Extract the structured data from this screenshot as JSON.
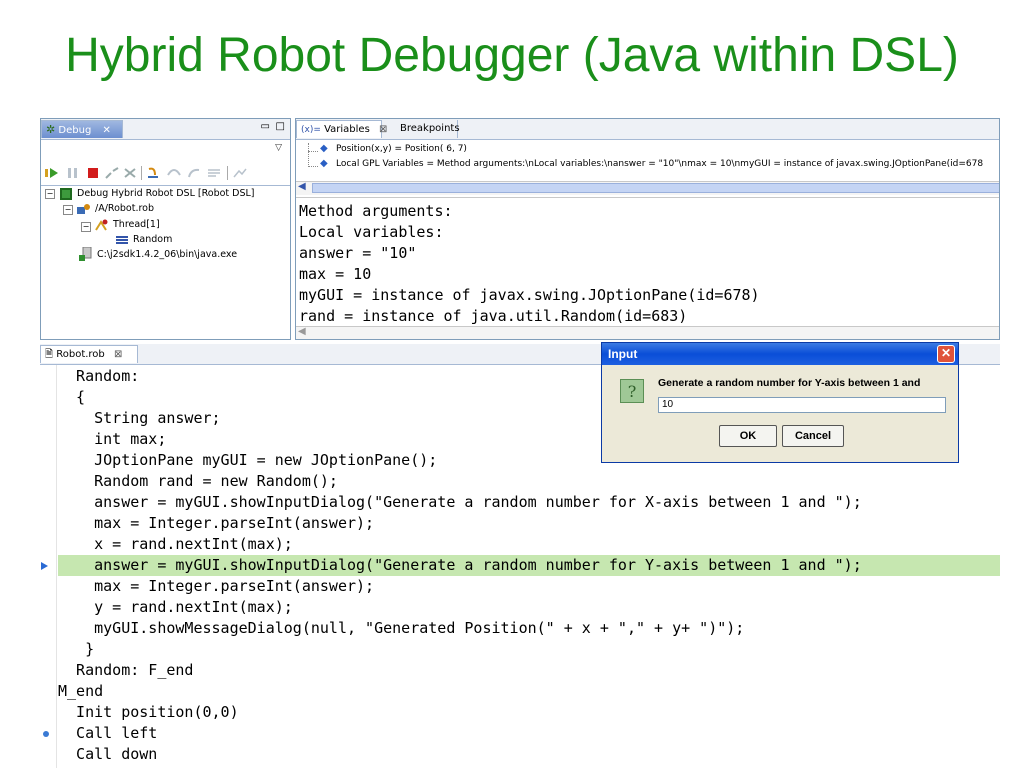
{
  "slide": {
    "title": "Hybrid Robot Debugger (Java within DSL)"
  },
  "debug_view": {
    "tab_label": "Debug",
    "tree": [
      {
        "label": "Debug Hybrid Robot DSL [Robot DSL]"
      },
      {
        "label": "/A/Robot.rob"
      },
      {
        "label": "Thread[1]"
      },
      {
        "label": "Random"
      },
      {
        "label": "C:\\j2sdk1.4.2_06\\bin\\java.exe"
      }
    ]
  },
  "variables_view": {
    "tabs": [
      {
        "label": "Variables"
      },
      {
        "label": "Breakpoints"
      }
    ],
    "rows": [
      {
        "text": "Position(x,y) = Position( 6, 7)"
      },
      {
        "text": "Local GPL Variables = Method arguments:\\nLocal variables:\\nanswer = \"10\"\\nmax = 10\\nmyGUI = instance of javax.swing.JOptionPane(id=678"
      }
    ],
    "detail_lines": [
      "Method arguments:",
      "Local variables:",
      "answer = \"10\"",
      "max = 10",
      "myGUI = instance of javax.swing.JOptionPane(id=678)",
      "rand = instance of java.util.Random(id=683)"
    ]
  },
  "editor": {
    "tab_label": "Robot.rob",
    "lines": [
      "  Random:",
      "  {",
      "    String answer;",
      "    int max;",
      "    JOptionPane myGUI = new JOptionPane();",
      "    Random rand = new Random();",
      "    answer = myGUI.showInputDialog(\"Generate a random number for X-axis between 1 and \");",
      "    max = Integer.parseInt(answer);",
      "    x = rand.nextInt(max);",
      "    answer = myGUI.showInputDialog(\"Generate a random number for Y-axis between 1 and \");",
      "    max = Integer.parseInt(answer);",
      "    y = rand.nextInt(max);",
      "    myGUI.showMessageDialog(null, \"Generated Position(\" + x + \",\" + y+ \")\");",
      "   }",
      "  Random: F_end",
      "M_end",
      "  Init position(0,0)",
      "  Call left",
      "  Call down"
    ],
    "current_line_index": 9,
    "highlight_color": "#c6e7b0"
  },
  "input_dialog": {
    "title": "Input",
    "message": "Generate a random number for Y-axis between 1 and",
    "input_value": "10",
    "ok_label": "OK",
    "cancel_label": "Cancel"
  }
}
